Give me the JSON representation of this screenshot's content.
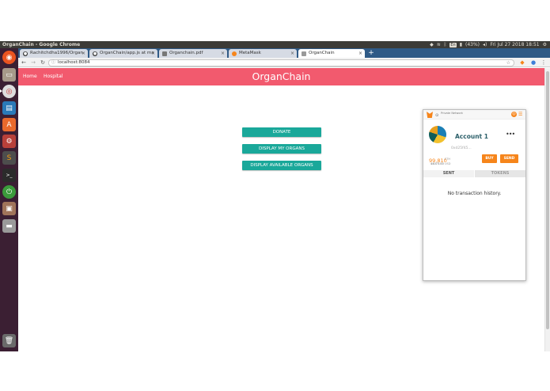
{
  "system": {
    "window_title": "OrganChain - Google Chrome",
    "tray": {
      "keyboard": "En",
      "battery": "(43%)",
      "clock": "Fri Jul 27 2018 18:51"
    }
  },
  "launcher": {
    "icons": [
      {
        "name": "ubuntu-dash-icon",
        "glyph": "◉",
        "color": "#e95420"
      },
      {
        "name": "files-icon",
        "glyph": "▭",
        "color": "#a69a8a"
      },
      {
        "name": "chrome-icon",
        "glyph": "◎",
        "color": "#cccccc"
      },
      {
        "name": "libreoffice-writer-icon",
        "glyph": "▤",
        "color": "#2a7ab8"
      },
      {
        "name": "software-center-icon",
        "glyph": "A",
        "color": "#e9692c"
      },
      {
        "name": "system-settings-icon",
        "glyph": "⚙",
        "color": "#b8403a"
      },
      {
        "name": "sublime-text-icon",
        "glyph": "S",
        "color": "#4d4d4d"
      },
      {
        "name": "terminal-icon",
        "glyph": ">_",
        "color": "#2b2b2b"
      },
      {
        "name": "power-icon",
        "glyph": "⏻",
        "color": "#3b9b3b"
      },
      {
        "name": "box-icon",
        "glyph": "▣",
        "color": "#a0745a"
      },
      {
        "name": "drive-icon",
        "glyph": "▬",
        "color": "#9a9a9a"
      },
      {
        "name": "trash-icon",
        "glyph": "🗑",
        "color": "#6a6a6a"
      }
    ]
  },
  "browser": {
    "tabs": [
      {
        "label": "Rachitchdha1996/Organ",
        "favicon": "github-icon"
      },
      {
        "label": "OrganChain/app.js at ma",
        "favicon": "github-icon"
      },
      {
        "label": "Organchain.pdf",
        "favicon": "file-icon"
      },
      {
        "label": "MetaMask",
        "favicon": "metamask-icon"
      },
      {
        "label": "OrganChain",
        "favicon": "file-icon"
      }
    ],
    "new_tab": "+",
    "url": "localhost:8084"
  },
  "app": {
    "nav": {
      "home": "Home",
      "hospital": "Hospital"
    },
    "brand": "OrganChain",
    "buttons": {
      "donate": "DONATE",
      "display_my_organs": "DISPLAY MY ORGANS",
      "display_available_organs": "DISPLAY AVAILABLE ORGANS"
    },
    "colors": {
      "navbar": "#f25a6e",
      "button": "#1aa89a"
    }
  },
  "metamask": {
    "network_label": "Private Network",
    "account_name": "Account 1",
    "address": "0xd25f45...",
    "balance_eth": "99.810",
    "eth_unit": "ETH",
    "balance_usd": "44073.00",
    "usd_unit": "USD",
    "buy_label": "BUY",
    "send_label": "SEND",
    "tab_sent": "SENT",
    "tab_tokens": "TOKENS",
    "empty_history": "No transaction history.",
    "accent_color": "#f6851b"
  }
}
